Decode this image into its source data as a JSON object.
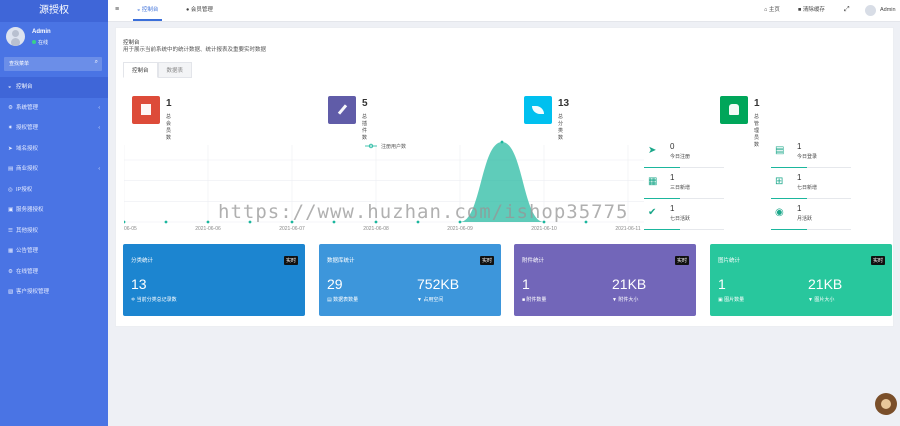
{
  "sidebar": {
    "logo": "源授权",
    "user": {
      "name": "Admin",
      "status": "在线"
    },
    "search_label": "查找菜单",
    "items": [
      {
        "label": "控制台",
        "icon": "dashboard-icon"
      },
      {
        "label": "系统管理",
        "icon": "gear-icon"
      },
      {
        "label": "授权管理",
        "icon": "key-icon"
      },
      {
        "label": "域名授权",
        "icon": "rocket-icon"
      },
      {
        "label": "商业授权",
        "icon": "shop-icon"
      },
      {
        "label": "IP授权",
        "icon": "globe-icon"
      },
      {
        "label": "服务器授权",
        "icon": "server-icon"
      },
      {
        "label": "其他授权",
        "icon": "list-icon"
      },
      {
        "label": "公告管理",
        "icon": "bell-icon"
      },
      {
        "label": "在线管理",
        "icon": "monitor-icon"
      },
      {
        "label": "客户授权管理",
        "icon": "users-icon"
      }
    ]
  },
  "topbar": {
    "tab1": "控制台",
    "tab2": "会员管理",
    "home": "主页",
    "clear_cache": "清除缓存",
    "user": "Admin"
  },
  "page": {
    "title": "控制台",
    "desc": "用于展示当前系统中的统计数据、统计报表及重要实时数据",
    "tabs": [
      "控制台",
      "数据表"
    ]
  },
  "stats": [
    {
      "value": "1",
      "label": "总会员数",
      "color": "#dd4b39"
    },
    {
      "value": "5",
      "label": "总插件数",
      "color": "#605ca8"
    },
    {
      "value": "13",
      "label": "总分类数",
      "color": "#00c0ef"
    },
    {
      "value": "1",
      "label": "总管理员数",
      "color": "#00a65a"
    }
  ],
  "chart_data": {
    "type": "area",
    "series": [
      {
        "name": "注册用户数",
        "values": [
          0,
          0,
          0,
          0,
          0,
          0,
          0,
          0,
          0,
          1,
          0,
          0
        ]
      }
    ],
    "x": [
      "2021-06-06",
      "2021-06-07",
      "2021-06-08",
      "2021-06-09",
      "2021-06-10",
      "2021-06-11",
      "2021-06-12",
      "2021-06-13",
      "2021-06-14",
      "2021-06-15",
      "2021-06-16",
      "2021-06-17"
    ],
    "tick_labels": [
      "06-05",
      "2021-06-06",
      "2021-06-07",
      "2021-06-08",
      "2021-06-09",
      "2021-06-10",
      "2021-06-11",
      "2021-06-12",
      "2021-06-13",
      "2021-06-14",
      "2021-06-15",
      "2021-06-16"
    ],
    "legend": "top-center",
    "color": "#1bb69d",
    "grid": true
  },
  "minis": [
    {
      "value": "0",
      "label": "今日注册",
      "icon": "rocket-icon"
    },
    {
      "value": "1",
      "label": "今日登录",
      "icon": "id-card-icon"
    },
    {
      "value": "1",
      "label": "三日新增",
      "icon": "calendar-icon"
    },
    {
      "value": "1",
      "label": "七日新增",
      "icon": "calendar-plus-icon"
    },
    {
      "value": "1",
      "label": "七日活跃",
      "icon": "check-circle-icon"
    },
    {
      "value": "1",
      "label": "月活跃",
      "icon": "user-circle-icon"
    }
  ],
  "cards": [
    {
      "title": "分类统计",
      "badge": "实时",
      "left_value": "13",
      "left_label": "当前分类总记录数",
      "right_value": "",
      "right_label": "",
      "color": "#1c85d0"
    },
    {
      "title": "数据库统计",
      "badge": "实时",
      "left_value": "29",
      "left_label": "数据表数量",
      "right_value": "752KB",
      "right_label": "占用空间",
      "color": "#3d96db"
    },
    {
      "title": "附件统计",
      "badge": "实时",
      "left_value": "1",
      "left_label": "附件数量",
      "right_value": "21KB",
      "right_label": "附件大小",
      "color": "#7266b9"
    },
    {
      "title": "图片统计",
      "badge": "实时",
      "left_value": "1",
      "left_label": "图片数量",
      "right_value": "21KB",
      "right_label": "图片大小",
      "color": "#28c79d"
    }
  ],
  "watermark": "https://www.huzhan.com/ishop35775"
}
